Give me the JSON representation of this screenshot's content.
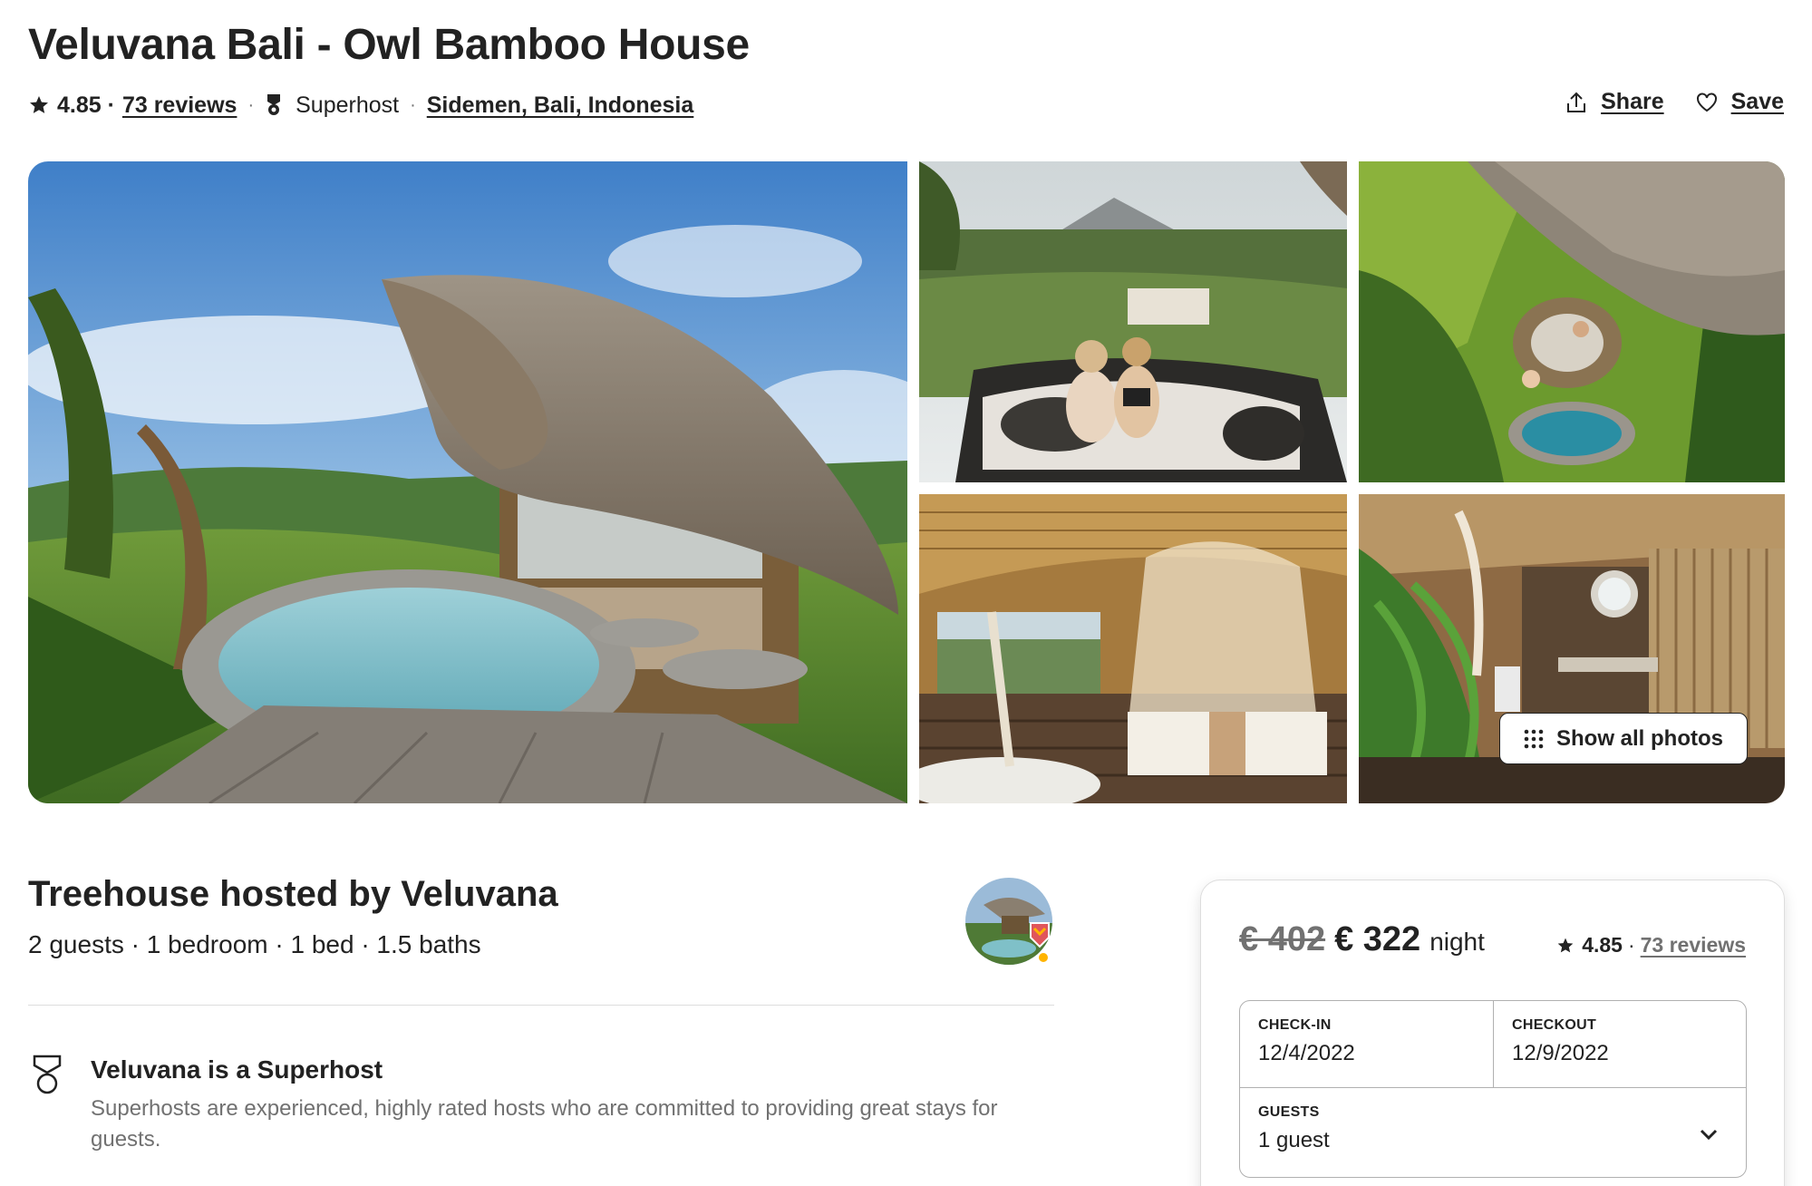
{
  "listing": {
    "title": "Veluvana Bali - Owl Bamboo House",
    "rating": "4.85 ·",
    "reviews_link": "73 reviews",
    "superhost_label": "Superhost",
    "location": "Sidemen, Bali, Indonesia"
  },
  "actions": {
    "share_label": "Share",
    "save_label": "Save"
  },
  "gallery": {
    "show_all_label": "Show all photos",
    "photos": [
      {
        "name": "main-photo-owl-bamboo-house-plunge-pool"
      },
      {
        "name": "photo-couple-on-net-deck"
      },
      {
        "name": "photo-aerial-house-and-pool"
      },
      {
        "name": "photo-bedroom-mosquito-net"
      },
      {
        "name": "photo-outdoor-bathroom"
      }
    ]
  },
  "host": {
    "title": "Treehouse hosted by Veluvana",
    "details": "2 guests · 1 bedroom · 1 bed · 1.5 baths"
  },
  "superhost_section": {
    "title": "Veluvana is a Superhost",
    "description": "Superhosts are experienced, highly rated hosts who are committed to providing great stays for guests."
  },
  "booking": {
    "old_price": "€ 402",
    "new_price": "€ 322",
    "per": "night",
    "rating": "4.85",
    "reviews_link": "73 reviews",
    "checkin_label": "CHECK-IN",
    "checkin_value": "12/4/2022",
    "checkout_label": "CHECKOUT",
    "checkout_value": "12/9/2022",
    "guests_label": "GUESTS",
    "guests_value": "1 guest"
  },
  "icons": {
    "star": "star-icon",
    "medal": "superhost-medal-icon",
    "share": "share-icon",
    "save": "heart-icon",
    "grid": "grid-dots-icon",
    "chevron": "chevron-down-icon"
  }
}
